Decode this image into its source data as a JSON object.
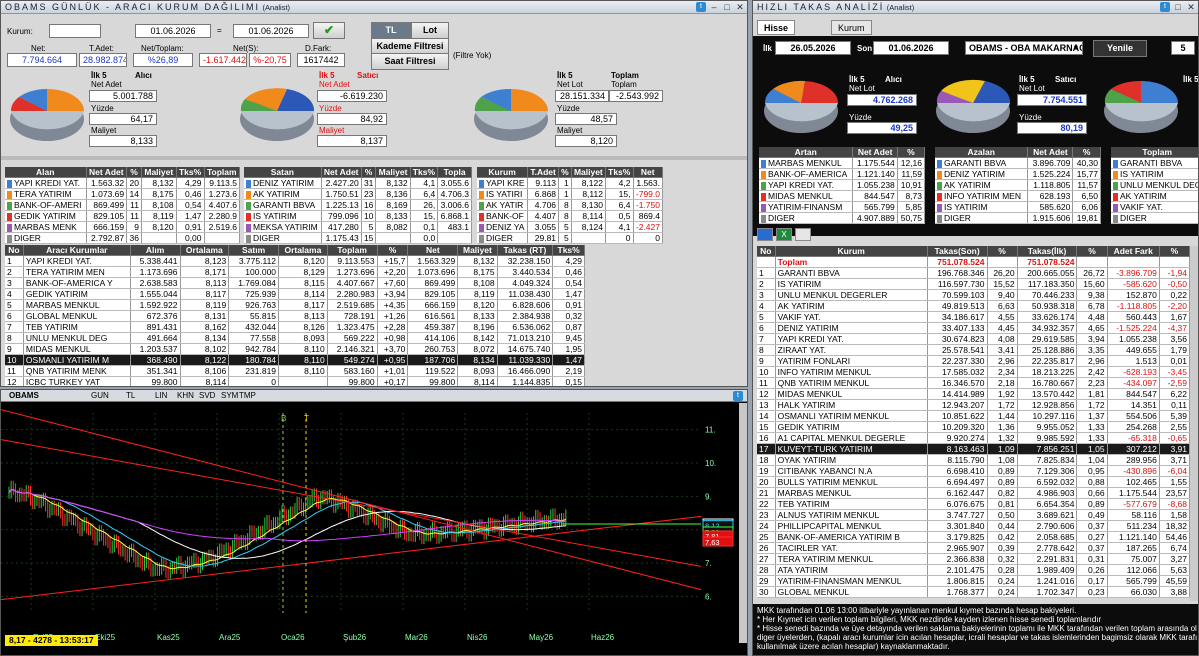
{
  "left": {
    "title": "OBAMS GÜNLÜK - ARACI KURUM DAĞILIMI",
    "title_sub": "(Analist)",
    "kurum_label": "Kurum:",
    "date_from": "01.06.2026",
    "eq": "=",
    "date_to": "01.06.2026",
    "tl": "TL",
    "lot": "Lot",
    "kademe": "Kademe Filtresi",
    "saat": "Saat Filtresi",
    "filtre": "(Filtre Yok)",
    "net_lbl": "Net:",
    "tadet_lbl": "T.Adet:",
    "nettoplam_lbl": "Net/Toplam:",
    "nets_lbl": "Net(S):",
    "dfark_lbl": "D.Fark:",
    "net": "7.794.664",
    "tadet": "28.982.874",
    "nettoplam": "%26,89",
    "nets": "-1.617.442",
    "nets_pct": "%-20,75",
    "dfark": "1617442",
    "pies": [
      {
        "t1": "İlk 5",
        "t2": "Alıcı",
        "netlbl": "Net Adet",
        "net": "5.001.788",
        "yz": "Yüzde",
        "yzv": "64,17",
        "ml": "Maliyet",
        "mv": "8,133"
      },
      {
        "t1": "İlk 5",
        "t2": "Satıcı",
        "netlbl": "Net Adet",
        "net": "-6.619.230",
        "yz": "Yüzde",
        "yzv": "84,92",
        "ml": "Maliyet",
        "mv": "8,137"
      },
      {
        "t1": "İlk 5",
        "t2": "Toplam",
        "netlbl": "Net Lot",
        "net": "28.151.334",
        "net2": "-2.543.992",
        "t3": "Toplam",
        "yz": "Yüzde",
        "yzv": "48,57",
        "ml": "Maliyet",
        "mv": "8,120"
      }
    ],
    "alan_hd": [
      "Alan",
      "Net Adet",
      "%",
      "Maliyet",
      "Tks%",
      "Toplam"
    ],
    "alan": [
      [
        "YAPI KREDI YAT.",
        "1.563.32",
        "20",
        "8,132",
        "4,29",
        "9.113.5"
      ],
      [
        "TERA YATIRIM",
        "1.073.69",
        "14",
        "8,175",
        "0,46",
        "1.273.6"
      ],
      [
        "BANK-OF-AMERI",
        "869.499",
        "11",
        "8,108",
        "0,54",
        "4.407.6"
      ],
      [
        "GEDIK YATIRIM",
        "829.105",
        "11",
        "8,119",
        "1,47",
        "2.280.9"
      ],
      [
        "MARBAS MENK",
        "666.159",
        "9",
        "8,120",
        "0,91",
        "2.519.6"
      ],
      [
        "DIGER",
        "2.792.87",
        "36",
        "",
        "0,00",
        ""
      ]
    ],
    "satan_hd": [
      "Satan",
      "Net Adet",
      "%",
      "Maliyet",
      "Tks%",
      "Topla"
    ],
    "satan": [
      [
        "DENIZ YATIRIM",
        "2.427.20",
        "31",
        "8,132",
        "4,1",
        "3.055.6"
      ],
      [
        "AK YATIRIM",
        "1.750.51",
        "23",
        "8,136",
        "6,4",
        "4.706.3"
      ],
      [
        "GARANTI BBVA",
        "1.225.13",
        "16",
        "8,169",
        "26,",
        "3.006.6"
      ],
      [
        "IS YATIRIM",
        "799.096",
        "10",
        "8,133",
        "15,",
        "6.868.1"
      ],
      [
        "MEKSA YATIRIM",
        "417.280",
        "5",
        "8,082",
        "0,1",
        "483.1"
      ],
      [
        "DIGER",
        "1.175.43",
        "15",
        "",
        "0,0",
        ""
      ]
    ],
    "kurum_hd": [
      "Kurum",
      "T.Adet",
      "%",
      "Maliyet",
      "Tks%",
      "Net"
    ],
    "kurum": [
      [
        "YAPI KRE",
        "9.113",
        "1",
        "8,122",
        "4,2",
        "1.563."
      ],
      [
        "IS YATIRI",
        "6.868",
        "1",
        "8,112",
        "15,",
        "-799.0"
      ],
      [
        "AK YATIR",
        "4.706",
        "8",
        "8,130",
        "6,4",
        "-1.750"
      ],
      [
        "BANK-OF",
        "4.407",
        "8",
        "8,114",
        "0,5",
        "869.4"
      ],
      [
        "DENIZ YA",
        "3.055",
        "5",
        "8,124",
        "4,1",
        "-2.427"
      ],
      [
        "DIGER",
        "29.81",
        "5",
        "",
        "0",
        "0"
      ]
    ],
    "main_hd": [
      "No",
      "Aracı Kurumlar",
      "Alım",
      "Ortalama",
      "Satım",
      "Ortalama",
      "Toplam",
      "%",
      "Net",
      "Maliyet",
      "Takas (RT)",
      "Tks%"
    ],
    "main": [
      [
        "1",
        "YAPI KREDI YAT.",
        "5.338.441",
        "8,123",
        "3.775.112",
        "8,120",
        "9.113.553",
        "+15,7",
        "1.563.329",
        "8,132",
        "32.238.150",
        "4,29"
      ],
      [
        "2",
        "TERA YATIRIM MEN",
        "1.173.696",
        "8,171",
        "100.000",
        "8,129",
        "1.273.696",
        "+2,20",
        "1.073.696",
        "8,175",
        "3.440.534",
        "0,46"
      ],
      [
        "3",
        "BANK-OF-AMERICA Y",
        "2.638.583",
        "8,113",
        "1.769.084",
        "8,115",
        "4.407.667",
        "+7,60",
        "869.499",
        "8,108",
        "4.049.324",
        "0,54"
      ],
      [
        "4",
        "GEDIK YATIRIM",
        "1.555.044",
        "8,117",
        "725.939",
        "8,114",
        "2.280.983",
        "+3,94",
        "829.105",
        "8,119",
        "11.038.430",
        "1,47"
      ],
      [
        "5",
        "MARBAS MENKUL",
        "1.592.922",
        "8,119",
        "926.763",
        "8,117",
        "2.519.685",
        "+4,35",
        "666.159",
        "8,120",
        "6.828.606",
        "0,91"
      ],
      [
        "6",
        "GLOBAL MENKUL",
        "672.376",
        "8,131",
        "55.815",
        "8,113",
        "728.191",
        "+1,26",
        "616.561",
        "8,133",
        "2.384.938",
        "0,32"
      ],
      [
        "7",
        "TEB YATIRIM",
        "891.431",
        "8,162",
        "432.044",
        "8,126",
        "1.323.475",
        "+2,28",
        "459.387",
        "8,196",
        "6.536.062",
        "0,87"
      ],
      [
        "8",
        "UNLU MENKUL DEG",
        "491.664",
        "8,134",
        "77.558",
        "8,093",
        "569.222",
        "+0,98",
        "414.106",
        "8,142",
        "71.013.210",
        "9,45"
      ],
      [
        "9",
        "MIDAS MENKUL",
        "1.203.537",
        "8,102",
        "942.784",
        "8,110",
        "2.146.321",
        "+3,70",
        "260.753",
        "8,072",
        "14.675.740",
        "1,95"
      ],
      [
        "10",
        "OSMANLI YATIRIM M",
        "368.490",
        "8,122",
        "180.784",
        "8,110",
        "549.274",
        "+0,95",
        "187.706",
        "8,134",
        "11.039.330",
        "1,47"
      ],
      [
        "11",
        "QNB YATIRIM MENK",
        "351.341",
        "8,106",
        "231.819",
        "8,110",
        "583.160",
        "+1,01",
        "119.522",
        "8,093",
        "16.466.090",
        "2,19"
      ],
      [
        "12",
        "ICBC TURKEY YAT",
        "99.800",
        "8,114",
        "0",
        "",
        "99.800",
        "+0,17",
        "99.800",
        "8,114",
        "1.144.835",
        "0,15"
      ]
    ]
  },
  "chart": {
    "symbol": "OBAMS",
    "tools": [
      "GUN",
      "TL",
      "LIN",
      "KHN",
      "SVD",
      "SYM",
      "TMP"
    ],
    "prices": [
      "11.",
      "10.",
      "9.",
      "8.",
      "7.",
      "6."
    ],
    "price_tags": [
      "8.17",
      "8.12",
      "7.93",
      "7.81",
      "7.63"
    ],
    "months": [
      "Eyl25",
      "Eki25",
      "Kas25",
      "Ara25",
      "Oca26",
      "Şub26",
      "Mar26",
      "Nis26",
      "May26",
      "Haz26"
    ],
    "status": "8,17 - 4278 - 13:53:17",
    "markers": [
      "B",
      "T"
    ]
  },
  "right": {
    "title": "HIZLI TAKAS ANALİZİ",
    "title_sub": "(Analist)",
    "tabs": [
      "Hisse",
      "Kurum"
    ],
    "ilk": "İlk",
    "son": "Son",
    "d1": "26.05.2026",
    "d2": "01.06.2026",
    "sym": "OBAMS - OBA MAKARNACILIK",
    "yenile": "Yenile",
    "num": "5",
    "pies": [
      {
        "t1": "İlk 5",
        "t2": "Alıcı",
        "netlbl": "Net Lot",
        "net": "4.762.268",
        "yz": "Yüzde",
        "yzv": "49,25"
      },
      {
        "t1": "İlk 5",
        "t2": "Satıcı",
        "netlbl": "Net Lot",
        "net": "7.754.551",
        "yz": "Yüzde",
        "yzv": "80,19"
      },
      {
        "t1": "İlk 5",
        "t2": "Toplam",
        "netlbl": "Toplam",
        "net": "",
        "yz": "Yüzde",
        "yzv": ""
      }
    ],
    "artan_hd": [
      "Artan",
      "Net Adet",
      "%"
    ],
    "artan": [
      [
        "MARBAS MENKUL",
        "1.175.544",
        "12,16"
      ],
      [
        "BANK-OF-AMERICA",
        "1.121.140",
        "11,59"
      ],
      [
        "YAPI KREDI YAT.",
        "1.055.238",
        "10,91"
      ],
      [
        "MIDAS MENKUL",
        "844.547",
        "8,73"
      ],
      [
        "YATIRIM-FINANSM",
        "565.799",
        "5,85"
      ],
      [
        "DIGER",
        "4.907.889",
        "50,75"
      ]
    ],
    "azalan_hd": [
      "Azalan",
      "Net Adet",
      "%"
    ],
    "azalan": [
      [
        "GARANTI BBVA",
        "3.896.709",
        "40,30"
      ],
      [
        "DENIZ YATIRIM",
        "1.525.224",
        "15,77"
      ],
      [
        "AK YATIRIM",
        "1.118.805",
        "11,57"
      ],
      [
        "INFO YATIRIM MEN",
        "628.193",
        "6,50"
      ],
      [
        "IS YATIRIM",
        "585.620",
        "6,06"
      ],
      [
        "DIGER",
        "1.915.606",
        "19,81"
      ]
    ],
    "top_hd": [
      "Toplam"
    ],
    "top": [
      "GARANTI BBVA",
      "IS YATIRIM",
      "UNLU MENKUL DEG",
      "AK YATIRIM",
      "VAKIF YAT.",
      "DIGER"
    ],
    "main_hd": [
      "No",
      "Kurum",
      "Takas(Son)",
      "%",
      "Takas(İlk)",
      "%",
      "Adet Fark",
      "%"
    ],
    "total": [
      "",
      "Toplam",
      "751.078.524",
      "",
      "751.078.524",
      "",
      "",
      ""
    ],
    "main": [
      [
        "1",
        "GARANTI BBVA",
        "196.768.346",
        "26,20",
        "200.665.055",
        "26,72",
        "-3.896.709",
        "-1,94"
      ],
      [
        "2",
        "IS YATIRIM",
        "116.597.730",
        "15,52",
        "117.183.350",
        "15,60",
        "-585.620",
        "-0,50"
      ],
      [
        "3",
        "UNLU MENKUL DEGERLER",
        "70.599.103",
        "9,40",
        "70.446.233",
        "9,38",
        "152.870",
        "0,22"
      ],
      [
        "4",
        "AK YATIRIM",
        "49.819.513",
        "6,63",
        "50.938.318",
        "6,78",
        "-1.118.805",
        "-2,20"
      ],
      [
        "5",
        "VAKIF YAT.",
        "34.186.617",
        "4,55",
        "33.626.174",
        "4,48",
        "560.443",
        "1,67"
      ],
      [
        "6",
        "DENIZ YATIRIM",
        "33.407.133",
        "4,45",
        "34.932.357",
        "4,65",
        "-1.525.224",
        "-4,37"
      ],
      [
        "7",
        "YAPI KREDI YAT.",
        "30.674.823",
        "4,08",
        "29.619.585",
        "3,94",
        "1.055.238",
        "3,56"
      ],
      [
        "8",
        "ZIRAAT YAT.",
        "25.578.541",
        "3,41",
        "25.128.886",
        "3,35",
        "449.655",
        "1,79"
      ],
      [
        "9",
        "YATIRIM FONLARI",
        "22.237.330",
        "2,96",
        "22.235.817",
        "2,96",
        "1.513",
        "0,01"
      ],
      [
        "10",
        "INFO YATIRIM MENKUL",
        "17.585.032",
        "2,34",
        "18.213.225",
        "2,42",
        "-628.193",
        "-3,45"
      ],
      [
        "11",
        "QNB YATIRIM MENKUL",
        "16.346.570",
        "2,18",
        "16.780.667",
        "2,23",
        "-434.097",
        "-2,59"
      ],
      [
        "12",
        "MIDAS MENKUL",
        "14.414.989",
        "1,92",
        "13.570.442",
        "1,81",
        "844.547",
        "6,22"
      ],
      [
        "13",
        "HALK YATIRIM",
        "12.943.207",
        "1,72",
        "12.928.856",
        "1,72",
        "14.351",
        "0,11"
      ],
      [
        "14",
        "OSMANLI YATIRIM MENKUL",
        "10.851.622",
        "1,44",
        "10.297.116",
        "1,37",
        "554.506",
        "5,39"
      ],
      [
        "15",
        "GEDIK YATIRIM",
        "10.209.320",
        "1,36",
        "9.955.052",
        "1,33",
        "254.268",
        "2,55"
      ],
      [
        "16",
        "A1 CAPITAL MENKUL DEGERLE",
        "9.920.274",
        "1,32",
        "9.985.592",
        "1,33",
        "-65.318",
        "-0,65"
      ],
      [
        "17",
        "KUVEYT-TURK YATIRIM",
        "8.163.463",
        "1,09",
        "7.856.251",
        "1,05",
        "307.212",
        "3,91"
      ],
      [
        "18",
        "OYAK YATIRIM",
        "8.115.790",
        "1,08",
        "7.825.834",
        "1,04",
        "289.956",
        "3,71"
      ],
      [
        "19",
        "CITIBANK YABANCI N.A",
        "6.698.410",
        "0,89",
        "7.129.306",
        "0,95",
        "-430.896",
        "-6,04"
      ],
      [
        "20",
        "BULLS YATIRIM MENKUL",
        "6.694.497",
        "0,89",
        "6.592.032",
        "0,88",
        "102.465",
        "1,55"
      ],
      [
        "21",
        "MARBAS MENKUL",
        "6.162.447",
        "0,82",
        "4.986.903",
        "0,66",
        "1.175.544",
        "23,57"
      ],
      [
        "22",
        "TEB YATIRIM",
        "6.076.675",
        "0,81",
        "6.654.354",
        "0,89",
        "-577.679",
        "-8,68"
      ],
      [
        "23",
        "ALNUS YATIRIM MENKUL",
        "3.747.727",
        "0,50",
        "3.689.621",
        "0,49",
        "58.116",
        "1,58"
      ],
      [
        "24",
        "PHILLIPCAPITAL MENKUL",
        "3.301.840",
        "0,44",
        "2.790.606",
        "0,37",
        "511.234",
        "18,32"
      ],
      [
        "25",
        "BANK-OF-AMERICA YATIRIM B",
        "3.179.825",
        "0,42",
        "2.058.685",
        "0,27",
        "1.121.140",
        "54,46"
      ],
      [
        "26",
        "TACIRLER YAT.",
        "2.965.907",
        "0,39",
        "2.778.642",
        "0,37",
        "187.265",
        "6,74"
      ],
      [
        "27",
        "TERA YATIRIM MENKUL",
        "2.366.838",
        "0,32",
        "2.291.831",
        "0,31",
        "75.007",
        "3,27"
      ],
      [
        "28",
        "ATA YATIRIM",
        "2.101.475",
        "0,28",
        "1.989.409",
        "0,26",
        "112.066",
        "5,63"
      ],
      [
        "29",
        "YATIRIM-FINANSMAN MENKUL",
        "1.806.815",
        "0,24",
        "1.241.016",
        "0,17",
        "565.799",
        "45,59"
      ],
      [
        "30",
        "GLOBAL MENKUL",
        "1.768.377",
        "0,24",
        "1.702.347",
        "0,23",
        "66.030",
        "3,88"
      ]
    ],
    "notes": [
      "MKK tarafından 01.06 13:00 itibariyle yayınlanan menkul kıymet bazında hesap bakiyeleri.",
      "* Her Kıymet icin verilen toplam bilgileri, MKK nezdinde kayden izlenen hisse senedi toplamlarıdır",
      "* Hisse senedi bazında ve üye detayında verilen saklama bakiyelerinin toplamı ile MKK tarafından verilen toplam arasında olusan fark",
      "diger üyelerden, (kapalı aracı kurumlar icin acılan hesaplar, icrali hesaplar ve takas islemlerinden bagimsiz olarak MKK tarafından",
      "kullanılmak üzere acılan hesaplar) kaynaklanmaktadır."
    ]
  }
}
